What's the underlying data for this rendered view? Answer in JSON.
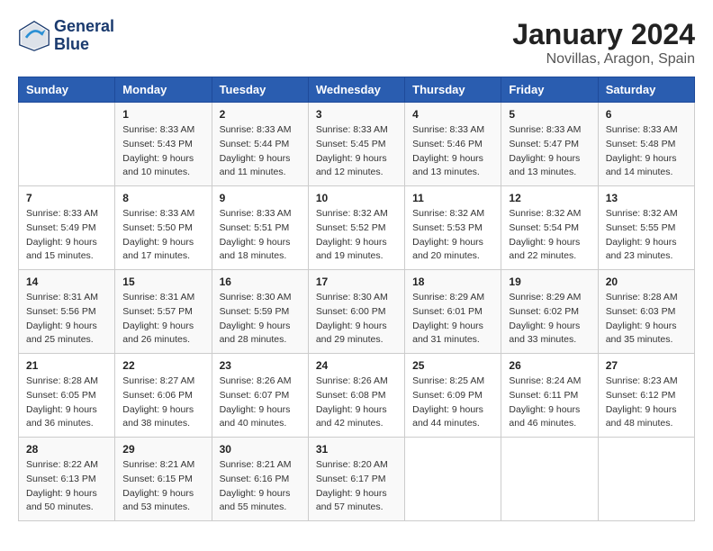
{
  "logo": {
    "line1": "General",
    "line2": "Blue"
  },
  "title": "January 2024",
  "location": "Novillas, Aragon, Spain",
  "days_of_week": [
    "Sunday",
    "Monday",
    "Tuesday",
    "Wednesday",
    "Thursday",
    "Friday",
    "Saturday"
  ],
  "weeks": [
    [
      {
        "day": "",
        "sunrise": "",
        "sunset": "",
        "daylight": ""
      },
      {
        "day": "1",
        "sunrise": "Sunrise: 8:33 AM",
        "sunset": "Sunset: 5:43 PM",
        "daylight": "Daylight: 9 hours and 10 minutes."
      },
      {
        "day": "2",
        "sunrise": "Sunrise: 8:33 AM",
        "sunset": "Sunset: 5:44 PM",
        "daylight": "Daylight: 9 hours and 11 minutes."
      },
      {
        "day": "3",
        "sunrise": "Sunrise: 8:33 AM",
        "sunset": "Sunset: 5:45 PM",
        "daylight": "Daylight: 9 hours and 12 minutes."
      },
      {
        "day": "4",
        "sunrise": "Sunrise: 8:33 AM",
        "sunset": "Sunset: 5:46 PM",
        "daylight": "Daylight: 9 hours and 13 minutes."
      },
      {
        "day": "5",
        "sunrise": "Sunrise: 8:33 AM",
        "sunset": "Sunset: 5:47 PM",
        "daylight": "Daylight: 9 hours and 13 minutes."
      },
      {
        "day": "6",
        "sunrise": "Sunrise: 8:33 AM",
        "sunset": "Sunset: 5:48 PM",
        "daylight": "Daylight: 9 hours and 14 minutes."
      }
    ],
    [
      {
        "day": "7",
        "sunrise": "Sunrise: 8:33 AM",
        "sunset": "Sunset: 5:49 PM",
        "daylight": "Daylight: 9 hours and 15 minutes."
      },
      {
        "day": "8",
        "sunrise": "Sunrise: 8:33 AM",
        "sunset": "Sunset: 5:50 PM",
        "daylight": "Daylight: 9 hours and 17 minutes."
      },
      {
        "day": "9",
        "sunrise": "Sunrise: 8:33 AM",
        "sunset": "Sunset: 5:51 PM",
        "daylight": "Daylight: 9 hours and 18 minutes."
      },
      {
        "day": "10",
        "sunrise": "Sunrise: 8:32 AM",
        "sunset": "Sunset: 5:52 PM",
        "daylight": "Daylight: 9 hours and 19 minutes."
      },
      {
        "day": "11",
        "sunrise": "Sunrise: 8:32 AM",
        "sunset": "Sunset: 5:53 PM",
        "daylight": "Daylight: 9 hours and 20 minutes."
      },
      {
        "day": "12",
        "sunrise": "Sunrise: 8:32 AM",
        "sunset": "Sunset: 5:54 PM",
        "daylight": "Daylight: 9 hours and 22 minutes."
      },
      {
        "day": "13",
        "sunrise": "Sunrise: 8:32 AM",
        "sunset": "Sunset: 5:55 PM",
        "daylight": "Daylight: 9 hours and 23 minutes."
      }
    ],
    [
      {
        "day": "14",
        "sunrise": "Sunrise: 8:31 AM",
        "sunset": "Sunset: 5:56 PM",
        "daylight": "Daylight: 9 hours and 25 minutes."
      },
      {
        "day": "15",
        "sunrise": "Sunrise: 8:31 AM",
        "sunset": "Sunset: 5:57 PM",
        "daylight": "Daylight: 9 hours and 26 minutes."
      },
      {
        "day": "16",
        "sunrise": "Sunrise: 8:30 AM",
        "sunset": "Sunset: 5:59 PM",
        "daylight": "Daylight: 9 hours and 28 minutes."
      },
      {
        "day": "17",
        "sunrise": "Sunrise: 8:30 AM",
        "sunset": "Sunset: 6:00 PM",
        "daylight": "Daylight: 9 hours and 29 minutes."
      },
      {
        "day": "18",
        "sunrise": "Sunrise: 8:29 AM",
        "sunset": "Sunset: 6:01 PM",
        "daylight": "Daylight: 9 hours and 31 minutes."
      },
      {
        "day": "19",
        "sunrise": "Sunrise: 8:29 AM",
        "sunset": "Sunset: 6:02 PM",
        "daylight": "Daylight: 9 hours and 33 minutes."
      },
      {
        "day": "20",
        "sunrise": "Sunrise: 8:28 AM",
        "sunset": "Sunset: 6:03 PM",
        "daylight": "Daylight: 9 hours and 35 minutes."
      }
    ],
    [
      {
        "day": "21",
        "sunrise": "Sunrise: 8:28 AM",
        "sunset": "Sunset: 6:05 PM",
        "daylight": "Daylight: 9 hours and 36 minutes."
      },
      {
        "day": "22",
        "sunrise": "Sunrise: 8:27 AM",
        "sunset": "Sunset: 6:06 PM",
        "daylight": "Daylight: 9 hours and 38 minutes."
      },
      {
        "day": "23",
        "sunrise": "Sunrise: 8:26 AM",
        "sunset": "Sunset: 6:07 PM",
        "daylight": "Daylight: 9 hours and 40 minutes."
      },
      {
        "day": "24",
        "sunrise": "Sunrise: 8:26 AM",
        "sunset": "Sunset: 6:08 PM",
        "daylight": "Daylight: 9 hours and 42 minutes."
      },
      {
        "day": "25",
        "sunrise": "Sunrise: 8:25 AM",
        "sunset": "Sunset: 6:09 PM",
        "daylight": "Daylight: 9 hours and 44 minutes."
      },
      {
        "day": "26",
        "sunrise": "Sunrise: 8:24 AM",
        "sunset": "Sunset: 6:11 PM",
        "daylight": "Daylight: 9 hours and 46 minutes."
      },
      {
        "day": "27",
        "sunrise": "Sunrise: 8:23 AM",
        "sunset": "Sunset: 6:12 PM",
        "daylight": "Daylight: 9 hours and 48 minutes."
      }
    ],
    [
      {
        "day": "28",
        "sunrise": "Sunrise: 8:22 AM",
        "sunset": "Sunset: 6:13 PM",
        "daylight": "Daylight: 9 hours and 50 minutes."
      },
      {
        "day": "29",
        "sunrise": "Sunrise: 8:21 AM",
        "sunset": "Sunset: 6:15 PM",
        "daylight": "Daylight: 9 hours and 53 minutes."
      },
      {
        "day": "30",
        "sunrise": "Sunrise: 8:21 AM",
        "sunset": "Sunset: 6:16 PM",
        "daylight": "Daylight: 9 hours and 55 minutes."
      },
      {
        "day": "31",
        "sunrise": "Sunrise: 8:20 AM",
        "sunset": "Sunset: 6:17 PM",
        "daylight": "Daylight: 9 hours and 57 minutes."
      },
      {
        "day": "",
        "sunrise": "",
        "sunset": "",
        "daylight": ""
      },
      {
        "day": "",
        "sunrise": "",
        "sunset": "",
        "daylight": ""
      },
      {
        "day": "",
        "sunrise": "",
        "sunset": "",
        "daylight": ""
      }
    ]
  ]
}
